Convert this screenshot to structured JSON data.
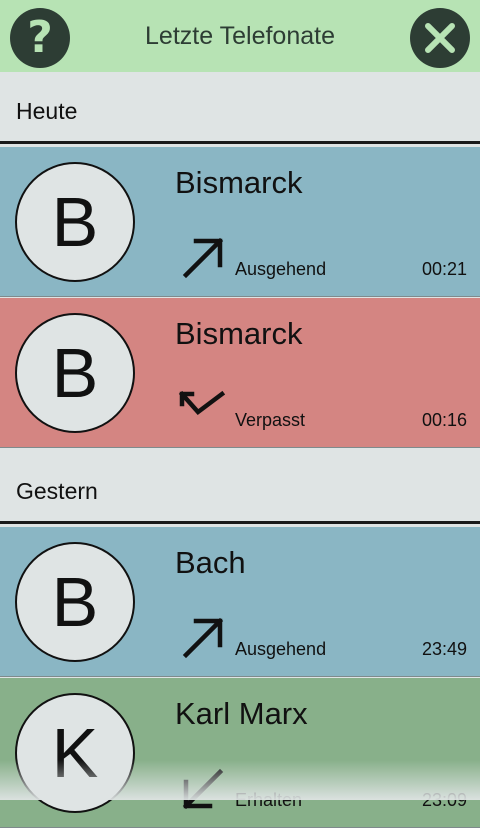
{
  "header": {
    "title": "Letzte Telefonate",
    "help_icon": "question-mark-icon",
    "close_icon": "close-x-icon"
  },
  "sections": [
    {
      "label": "Heute",
      "calls": [
        {
          "initial": "B",
          "name": "Bismarck",
          "direction": "Ausgehend",
          "icon": "outgoing-arrow-icon",
          "time": "00:21",
          "color": "#8ab6c4"
        },
        {
          "initial": "B",
          "name": "Bismarck",
          "direction": "Verpasst",
          "icon": "missed-call-icon",
          "time": "00:16",
          "color": "#d48582"
        }
      ]
    },
    {
      "label": "Gestern",
      "calls": [
        {
          "initial": "B",
          "name": "Bach",
          "direction": "Ausgehend",
          "icon": "outgoing-arrow-icon",
          "time": "23:49",
          "color": "#8ab6c4"
        },
        {
          "initial": "K",
          "name": "Karl Marx",
          "direction": "Erhalten",
          "icon": "incoming-arrow-icon",
          "time": "23:09",
          "color": "#88b08a"
        }
      ]
    }
  ],
  "colors": {
    "header_bg": "#b7e3b4",
    "header_button": "#2d3d34",
    "section_bg": "#dfe4e4",
    "outgoing": "#8ab6c4",
    "missed": "#d48582",
    "received": "#88b08a"
  }
}
